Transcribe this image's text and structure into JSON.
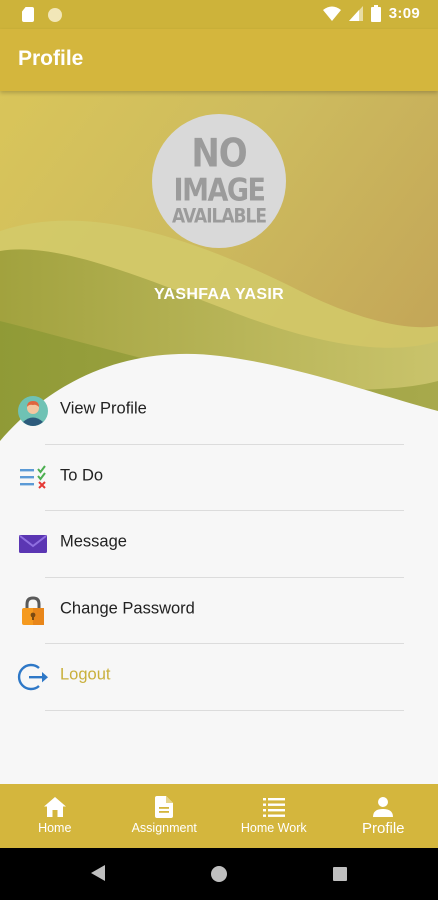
{
  "status_bar": {
    "time": "3:09",
    "left_icons": [
      "sd-card-icon",
      "circle-notification-icon"
    ],
    "right_icons": [
      "wifi-icon",
      "signal-icon",
      "battery-icon"
    ]
  },
  "app_bar": {
    "title": "Profile"
  },
  "profile": {
    "avatar_placeholder": {
      "line1": "NO",
      "line2": "IMAGE",
      "line3": "AVAILABLE"
    },
    "name": "YASHFAA YASIR"
  },
  "menu": {
    "items": [
      {
        "label": "View Profile",
        "icon": "user-avatar-icon"
      },
      {
        "label": "To Do",
        "icon": "checklist-icon"
      },
      {
        "label": "Message",
        "icon": "envelope-icon"
      },
      {
        "label": "Change Password",
        "icon": "padlock-icon"
      },
      {
        "label": "Logout",
        "icon": "logout-icon"
      }
    ]
  },
  "bottom_nav": {
    "items": [
      {
        "label": "Home",
        "icon": "home-icon"
      },
      {
        "label": "Assignment",
        "icon": "document-icon"
      },
      {
        "label": "Home Work",
        "icon": "list-icon"
      },
      {
        "label": "Profile",
        "icon": "person-icon",
        "active": true
      }
    ]
  },
  "system_nav": {
    "icons": [
      "back-icon",
      "home-circle-icon",
      "recents-icon"
    ]
  },
  "colors": {
    "accent": "#d4b63d",
    "status_bar": "#cdb33a",
    "logout_text": "#c9b03c",
    "background": "#f7f7f7"
  }
}
